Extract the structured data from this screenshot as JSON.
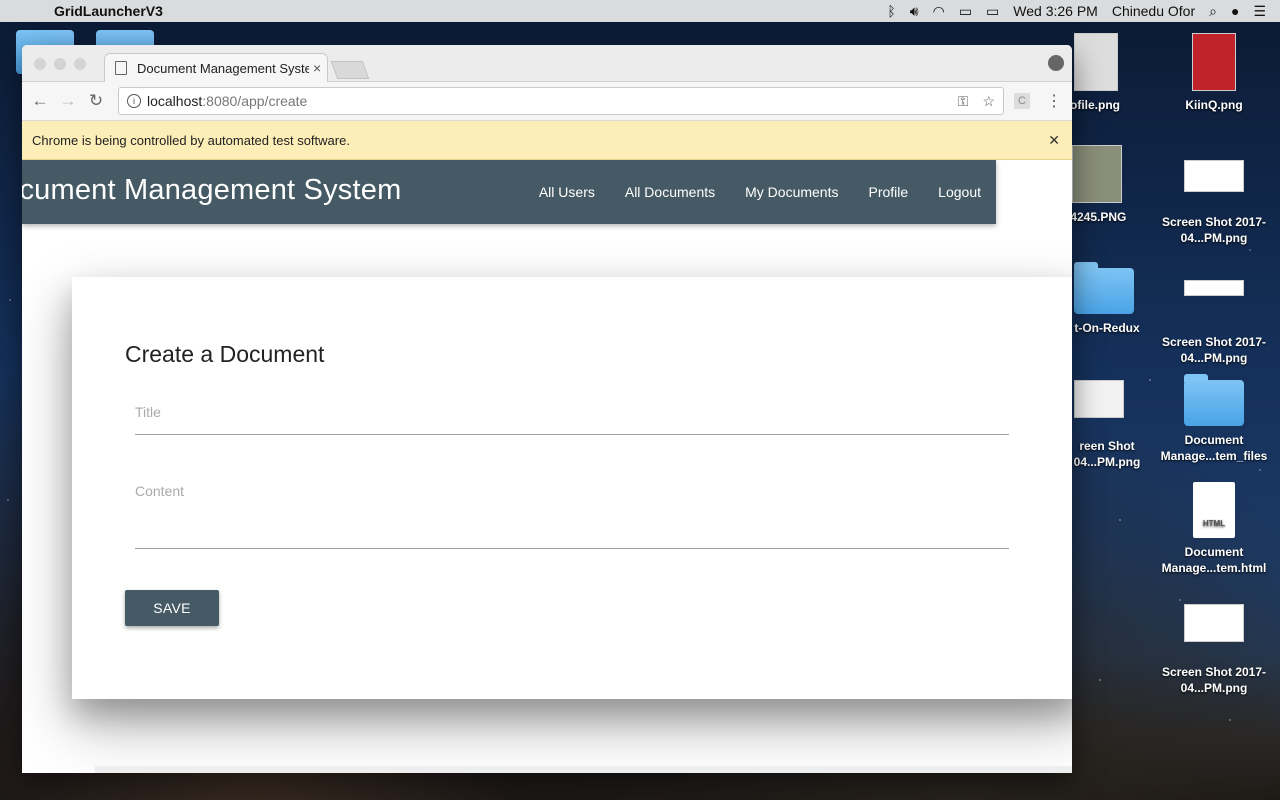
{
  "menubar": {
    "app_name": "GridLauncherV3",
    "datetime": "Wed 3:26 PM",
    "user": "Chinedu Ofor"
  },
  "desktop_icons": [
    {
      "label": "ofile.png"
    },
    {
      "label": "KiinQ.png"
    },
    {
      "label": "_4245.PNG"
    },
    {
      "label": "Screen Shot 2017-04...PM.png"
    },
    {
      "label": "t-On-Redux"
    },
    {
      "label": "Screen Shot 2017-04...PM.png"
    },
    {
      "label": "reen Shot 04...PM.png"
    },
    {
      "label": "Document Manage...tem_files"
    },
    {
      "label": "Document Manage...tem.html"
    },
    {
      "label": "Screen Shot 2017-04...PM.png"
    }
  ],
  "browser": {
    "tab_title": "Document Management System",
    "url_host": "localhost",
    "url_path": ":8080/app/create",
    "ext_label": "C",
    "infobar_message": "Chrome is being controlled by automated test software."
  },
  "app": {
    "brand": "Document Management System",
    "nav": [
      "All Users",
      "All Documents",
      "My Documents",
      "Profile",
      "Logout"
    ],
    "form_title": "Create a Document",
    "title_placeholder": "Title",
    "content_placeholder": "Content",
    "save_label": "SAVE"
  },
  "colors": {
    "appbar": "#455a64",
    "infobar": "#fdeeb8"
  }
}
